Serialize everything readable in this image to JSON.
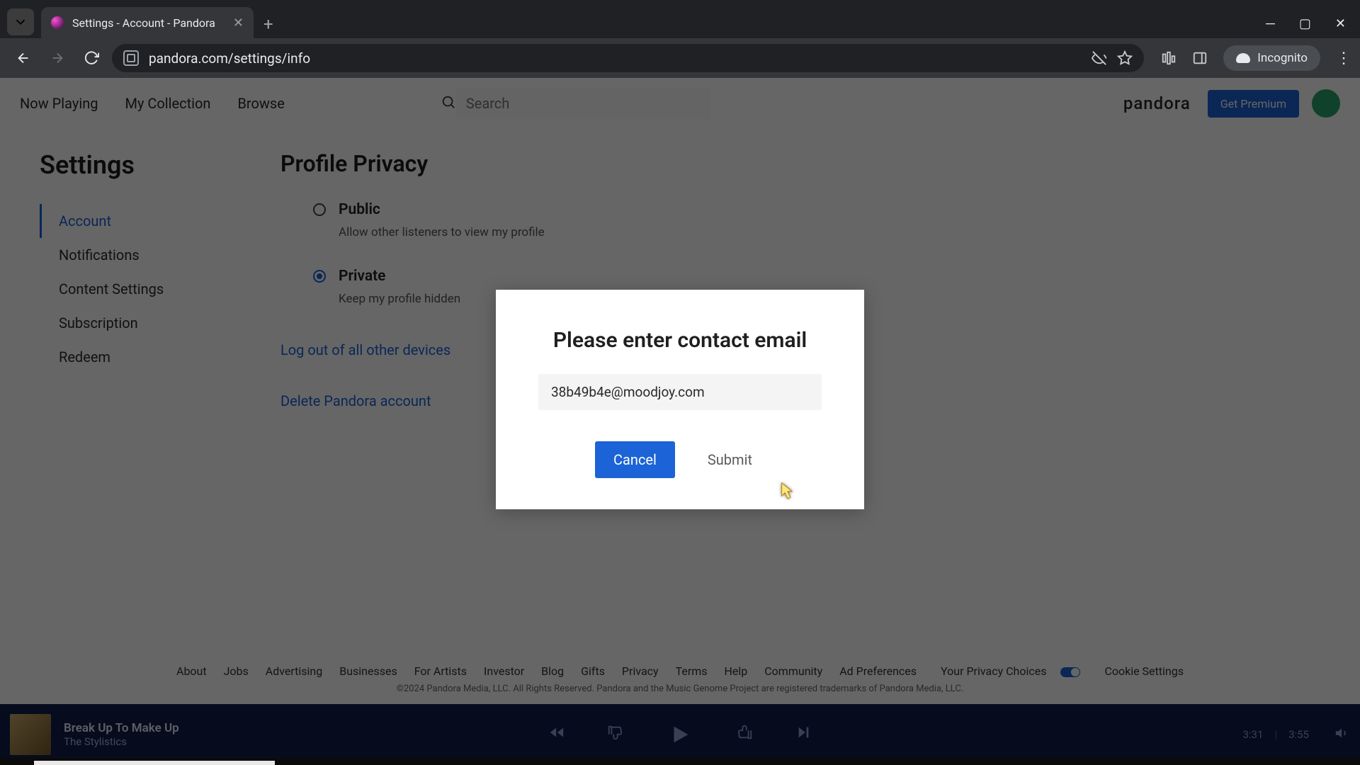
{
  "browser": {
    "tab_title": "Settings - Account - Pandora",
    "url": "pandora.com/settings/info",
    "incognito_label": "Incognito"
  },
  "header": {
    "nav": {
      "now_playing": "Now Playing",
      "my_collection": "My Collection",
      "browse": "Browse"
    },
    "search_placeholder": "Search",
    "brand": "pandora",
    "premium_label": "Get Premium"
  },
  "settings": {
    "title": "Settings",
    "side": {
      "account": "Account",
      "notifications": "Notifications",
      "content": "Content Settings",
      "subscription": "Subscription",
      "redeem": "Redeem"
    },
    "section_title": "Profile Privacy",
    "public": {
      "label": "Public",
      "desc": "Allow other listeners to view my profile"
    },
    "private": {
      "label": "Private",
      "desc": "Keep my profile hidden"
    },
    "logout_all": "Log out of all other devices",
    "delete_account": "Delete Pandora account"
  },
  "modal": {
    "title": "Please enter contact email",
    "email_value": "38b49b4e@moodjoy.com",
    "cancel": "Cancel",
    "submit": "Submit"
  },
  "footer": {
    "links": {
      "about": "About",
      "jobs": "Jobs",
      "advertising": "Advertising",
      "businesses": "Businesses",
      "for_artists": "For Artists",
      "investor": "Investor",
      "blog": "Blog",
      "gifts": "Gifts",
      "privacy": "Privacy",
      "terms": "Terms",
      "help": "Help",
      "community": "Community",
      "ad_preferences": "Ad Preferences",
      "your_privacy_choices": "Your Privacy Choices",
      "cookie_settings": "Cookie Settings"
    },
    "copyright": "©2024 Pandora Media, LLC. All Rights Reserved. Pandora and the Music Genome Project are registered trademarks of Pandora Media, LLC."
  },
  "player": {
    "track_title": "Break Up To Make Up",
    "artist": "The Stylistics",
    "elapsed": "3:31",
    "duration": "3:55"
  }
}
